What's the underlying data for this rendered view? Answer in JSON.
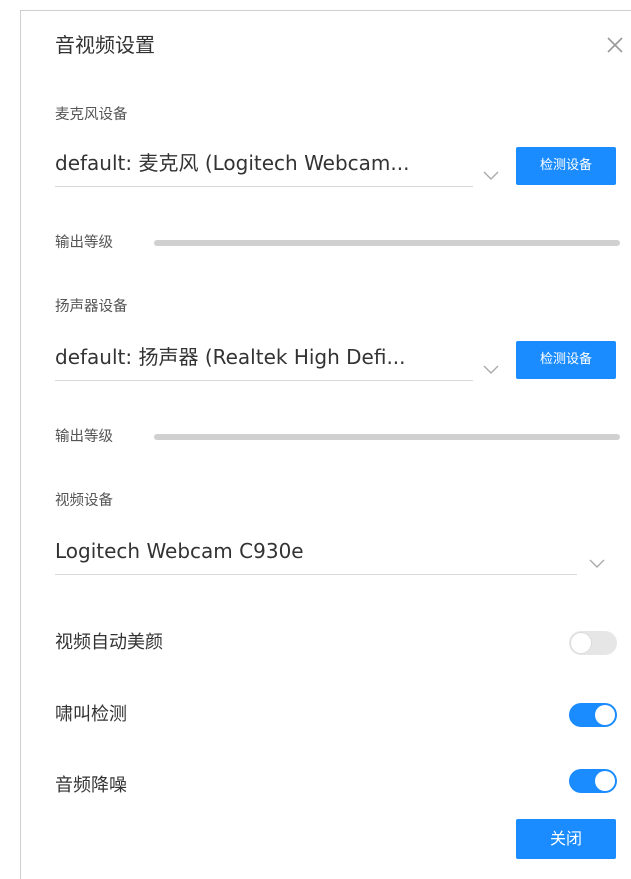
{
  "dialog": {
    "title": "音视频设置",
    "close_icon": "close-icon"
  },
  "microphone": {
    "label": "麦克风设备",
    "value": "default: 麦克风 (Logitech Webcam...",
    "detect_label": "检测设备",
    "level_label": "输出等级",
    "level": 0
  },
  "speaker": {
    "label": "扬声器设备",
    "value": "default: 扬声器 (Realtek High Defi...",
    "detect_label": "检测设备",
    "level_label": "输出等级",
    "level": 0
  },
  "video": {
    "label": "视频设备",
    "value": "Logitech Webcam C930e"
  },
  "toggles": [
    {
      "label": "视频自动美颜",
      "on": false
    },
    {
      "label": "啸叫检测",
      "on": true
    },
    {
      "label": "音频降噪",
      "on": true
    }
  ],
  "footer": {
    "close_label": "关闭"
  },
  "colors": {
    "accent": "#1a8cff",
    "toggle_off": "#e6e6e6",
    "level_track": "#d0d0d0"
  }
}
